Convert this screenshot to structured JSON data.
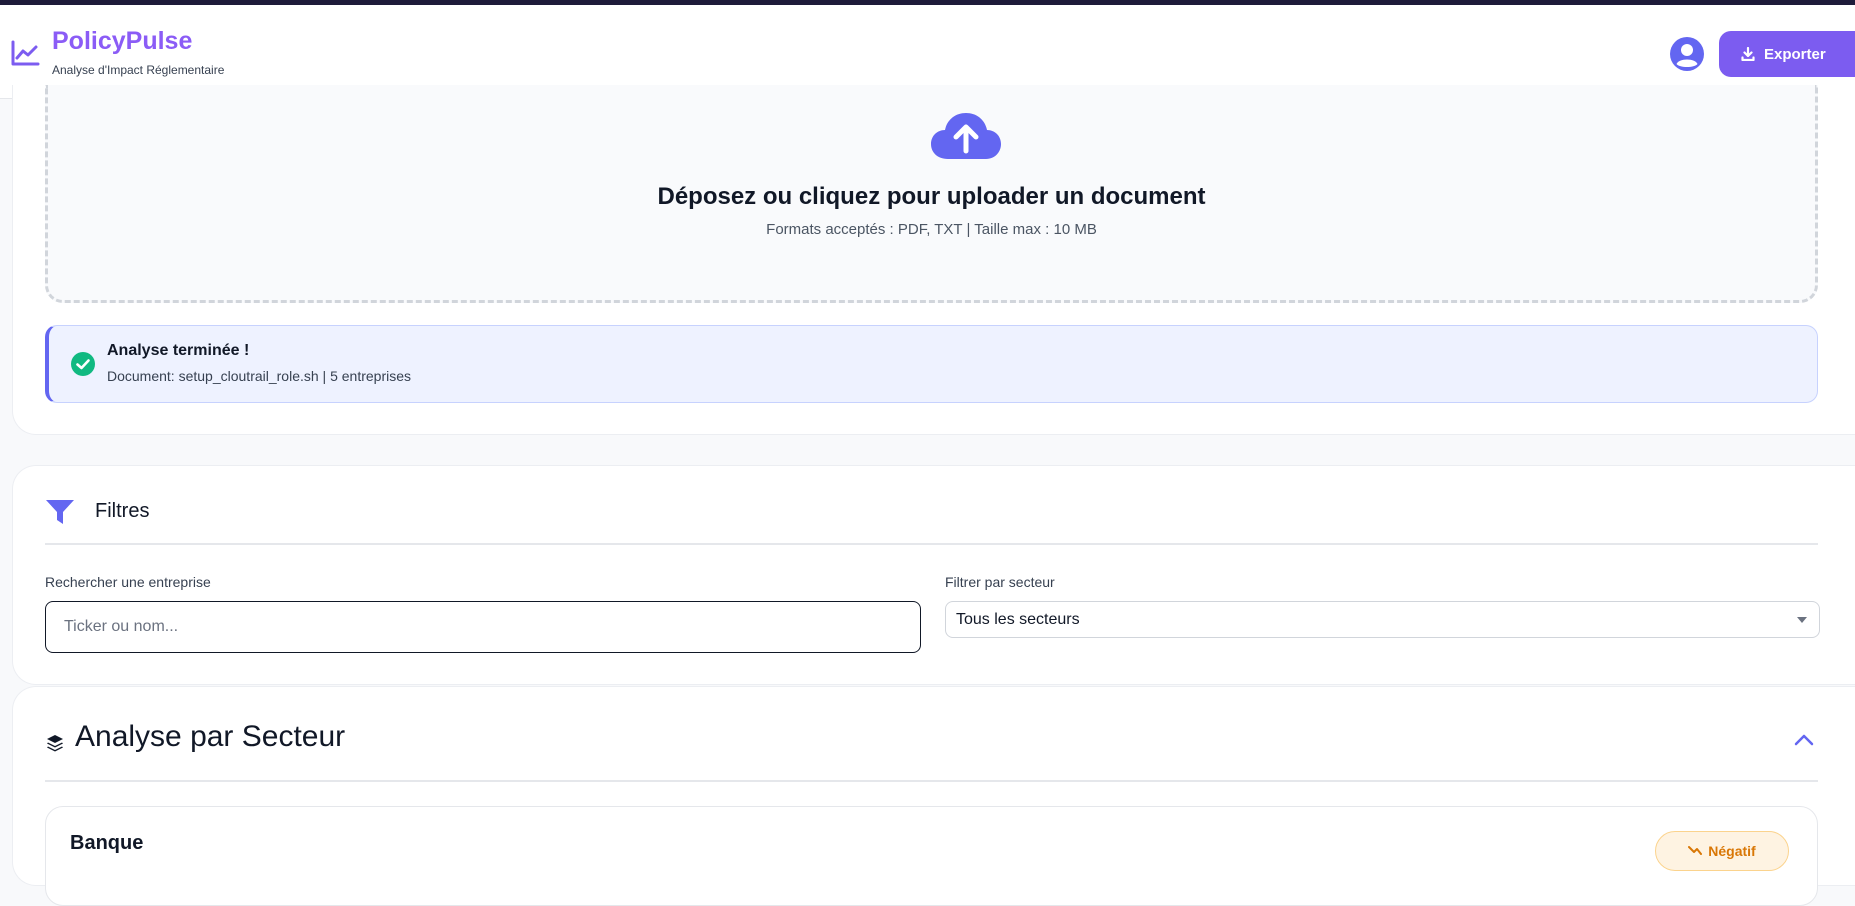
{
  "header": {
    "brand": "PolicyPulse",
    "subtitle": "Analyse d'Impact Réglementaire",
    "export_label": "Exporter"
  },
  "upload": {
    "title": "Déposez ou cliquez pour uploader un document",
    "formats": "Formats acceptés : PDF, TXT | Taille max : 10 MB"
  },
  "status": {
    "title": "Analyse terminée !",
    "detail": "Document: setup_cloutrail_role.sh | 5 entreprises"
  },
  "filters": {
    "title": "Filtres",
    "search_label": "Rechercher une entreprise",
    "search_placeholder": "Ticker ou nom...",
    "search_value": "",
    "sector_label": "Filtrer par secteur",
    "sector_selected": "Tous les secteurs"
  },
  "sector_analysis": {
    "title": "Analyse par Secteur",
    "first_sector": {
      "name": "Banque",
      "badge": "Négatif"
    }
  },
  "colors": {
    "accent": "#7c5cf0",
    "brand": "#8b5cf6",
    "success": "#10b981",
    "warning": "#d97706"
  },
  "icons": {
    "logo": "chart-line-icon",
    "avatar": "user-circle-icon",
    "export": "download-icon",
    "upload": "cloud-upload-icon",
    "success": "check-circle-icon",
    "filter": "funnel-icon",
    "sector": "layers-icon",
    "collapse": "chevron-up-icon"
  }
}
